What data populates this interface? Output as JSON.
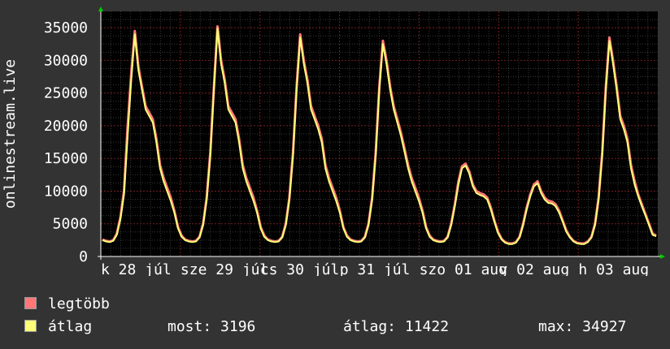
{
  "chart_data": {
    "type": "line",
    "ylabel": "onlinestream.live",
    "ylim": [
      0,
      37500
    ],
    "yticks": [
      0,
      5000,
      10000,
      15000,
      20000,
      25000,
      30000,
      35000
    ],
    "ytick_labels": [
      "0",
      "5000",
      "10000",
      "15000",
      "20000",
      "25000",
      "30000",
      "35000"
    ],
    "xtick_labels": [
      "k 28 júl",
      "sze 29 júl",
      "cs 30 júl",
      "p 31 júl",
      "szo 01 aug",
      "v 02 aug",
      "h 03 aug"
    ],
    "grid": true,
    "series": [
      {
        "name": "legtöbb",
        "color": "#ff7777",
        "values": [
          2600,
          2400,
          2300,
          2500,
          3500,
          6000,
          10000,
          20000,
          28000,
          34500,
          29000,
          26000,
          23000,
          22000,
          21000,
          18000,
          14000,
          12000,
          10500,
          9000,
          7000,
          4500,
          3200,
          2600,
          2400,
          2300,
          2400,
          3000,
          5000,
          9000,
          16000,
          26000,
          35200,
          30000,
          27000,
          23000,
          22000,
          21000,
          18000,
          14000,
          12000,
          10500,
          9000,
          7000,
          4500,
          3200,
          2600,
          2400,
          2300,
          2400,
          3000,
          5000,
          9000,
          16000,
          26000,
          34000,
          30000,
          27000,
          23000,
          21500,
          20000,
          18000,
          14000,
          12000,
          10500,
          9000,
          7000,
          4500,
          3200,
          2600,
          2400,
          2300,
          2400,
          3000,
          5000,
          9000,
          16000,
          26000,
          33000,
          30000,
          26000,
          23000,
          21000,
          19000,
          16500,
          14000,
          12000,
          10500,
          9000,
          7000,
          4500,
          3200,
          2600,
          2400,
          2300,
          2400,
          3000,
          5000,
          8000,
          11500,
          13800,
          14200,
          13000,
          11000,
          10000,
          9700,
          9500,
          9000,
          7500,
          5500,
          3800,
          2700,
          2200,
          2000,
          2000,
          2200,
          3000,
          5000,
          7500,
          9500,
          11000,
          11500,
          10000,
          9000,
          8500,
          8400,
          8000,
          7000,
          5500,
          4000,
          3000,
          2400,
          2100,
          2000,
          2000,
          2300,
          3000,
          5000,
          9000,
          16000,
          26000,
          33500,
          30000,
          26000,
          21500,
          20000,
          18000,
          14000,
          11500,
          9500,
          8000,
          6500,
          5000,
          3500,
          3200
        ],
        "legend_stats": null
      },
      {
        "name": "átlag",
        "color": "#ffff77",
        "values": [
          2500,
          2300,
          2200,
          2400,
          3300,
          5700,
          9500,
          18500,
          27000,
          34000,
          28500,
          25500,
          22500,
          21500,
          20500,
          17500,
          13500,
          11500,
          10000,
          8500,
          6700,
          4300,
          3000,
          2500,
          2300,
          2200,
          2300,
          2900,
          4800,
          8700,
          15500,
          25500,
          34900,
          29500,
          26500,
          22500,
          21500,
          20500,
          17500,
          13500,
          11500,
          10000,
          8500,
          6700,
          4300,
          3000,
          2500,
          2300,
          2200,
          2300,
          2900,
          4800,
          8700,
          15500,
          25500,
          33500,
          29500,
          26500,
          22500,
          21000,
          19500,
          17500,
          13500,
          11500,
          10000,
          8500,
          6700,
          4300,
          3000,
          2500,
          2300,
          2200,
          2300,
          2900,
          4800,
          8700,
          15500,
          25500,
          32500,
          29500,
          25500,
          22500,
          20500,
          18500,
          16000,
          13500,
          11500,
          10000,
          8500,
          6700,
          4300,
          3000,
          2500,
          2300,
          2200,
          2300,
          2900,
          4800,
          7700,
          11000,
          13500,
          13900,
          12700,
          10700,
          9700,
          9400,
          9200,
          8700,
          7200,
          5300,
          3600,
          2600,
          2100,
          1900,
          1900,
          2100,
          2900,
          4800,
          7200,
          9200,
          10700,
          11200,
          9700,
          8700,
          8200,
          8100,
          7700,
          6700,
          5300,
          3800,
          2900,
          2300,
          2000,
          1900,
          1900,
          2200,
          2900,
          4800,
          8700,
          15500,
          25500,
          33000,
          29500,
          25500,
          21000,
          19500,
          17500,
          13500,
          11000,
          9200,
          7700,
          6300,
          4800,
          3300,
          3100
        ]
      }
    ]
  },
  "legend": {
    "max_label": "legtöbb",
    "avg_label": "átlag",
    "max_color": "#ff7777",
    "avg_color": "#ffff77"
  },
  "stats": {
    "now": "most: 3196",
    "avg": "átlag: 11422",
    "max": "max: 34927"
  }
}
